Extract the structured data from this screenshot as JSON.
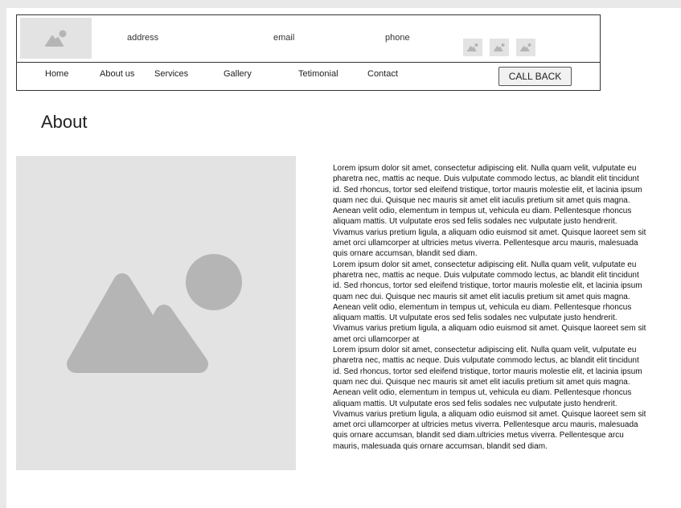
{
  "header": {
    "address": "address",
    "email": "email",
    "phone": "phone",
    "social_icons": [
      "image-icon",
      "image-icon",
      "image-icon"
    ]
  },
  "nav": {
    "items": [
      "Home",
      "About us",
      "Services",
      "Gallery",
      "Tetimonial",
      "Contact"
    ],
    "callback_label": "CALL BACK"
  },
  "main": {
    "title": "About",
    "hero_icon": "image-placeholder-icon",
    "paragraphs": [
      "Lorem ipsum dolor sit amet, consectetur adipiscing elit. Nulla quam velit, vulputate eu pharetra nec, mattis ac neque. Duis vulputate commodo lectus, ac blandit elit tincidunt id. Sed rhoncus, tortor sed eleifend tristique, tortor mauris molestie elit, et lacinia ipsum quam nec dui. Quisque nec mauris sit amet elit iaculis pretium sit amet quis magna. Aenean velit odio, elementum in tempus ut, vehicula eu diam. Pellentesque rhoncus aliquam mattis. Ut vulputate eros sed felis sodales nec vulputate justo hendrerit. Vivamus varius pretium ligula, a aliquam odio euismod sit amet. Quisque laoreet sem sit amet orci ullamcorper at ultricies metus viverra. Pellentesque arcu mauris, malesuada quis ornare accumsan, blandit sed diam.",
      "Lorem ipsum dolor sit amet, consectetur adipiscing elit. Nulla quam velit, vulputate eu pharetra nec, mattis ac neque. Duis vulputate commodo lectus, ac blandit elit tincidunt id. Sed rhoncus, tortor sed eleifend tristique, tortor mauris molestie elit, et lacinia ipsum quam nec dui. Quisque nec mauris sit amet elit iaculis pretium sit amet quis magna. Aenean velit odio, elementum in tempus ut, vehicula eu diam. Pellentesque rhoncus aliquam mattis. Ut vulputate eros sed felis sodales nec vulputate justo hendrerit. Vivamus varius pretium ligula, a aliquam odio euismod sit amet. Quisque laoreet sem sit amet orci ullamcorper at",
      "Lorem ipsum dolor sit amet, consectetur adipiscing elit. Nulla quam velit, vulputate eu pharetra nec, mattis ac neque. Duis vulputate commodo lectus, ac blandit elit tincidunt id. Sed rhoncus, tortor sed eleifend tristique, tortor mauris molestie elit, et lacinia ipsum quam nec dui. Quisque nec mauris sit amet elit iaculis pretium sit amet quis magna. Aenean velit odio, elementum in tempus ut, vehicula eu diam. Pellentesque rhoncus aliquam mattis. Ut vulputate eros sed felis sodales nec vulputate justo hendrerit. Vivamus varius pretium ligula, a aliquam odio euismod sit amet. Quisque laoreet sem sit amet orci ullamcorper at ultricies metus viverra. Pellentesque arcu mauris, malesuada quis ornare accumsan, blandit sed diam.ultricies metus viverra. Pellentesque arcu mauris, malesuada quis ornare accumsan, blandit sed diam."
    ]
  },
  "colors": {
    "placeholder_bg": "#e3e3e3",
    "placeholder_icon": "#b5b5b5",
    "border": "#333333"
  }
}
